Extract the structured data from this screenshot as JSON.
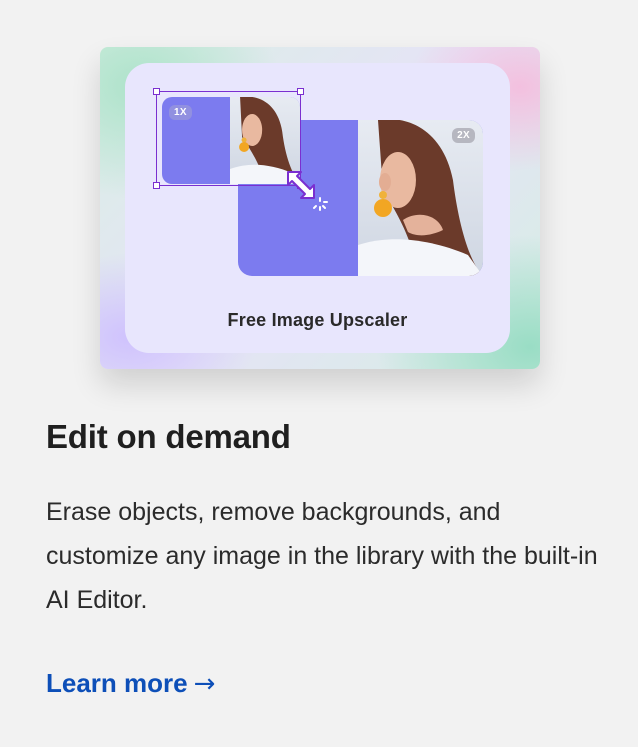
{
  "illustration": {
    "caption": "Free Image Upscaler",
    "badge_small": "1X",
    "badge_large": "2X",
    "icons": [
      "resize-arrow-icon",
      "loading-spinner-icon"
    ]
  },
  "feature": {
    "title": "Edit on demand",
    "description": "Erase objects, remove backgrounds, and customize any image in the library with the built-in AI Editor.",
    "link_label": "Learn more",
    "link_arrow": "→"
  },
  "colors": {
    "background": "#f2f2f2",
    "accent_link": "#0d4fb8",
    "selection": "#7a2fd0",
    "image_fill": "#7c7bef",
    "panel": "#e8e6fd"
  }
}
